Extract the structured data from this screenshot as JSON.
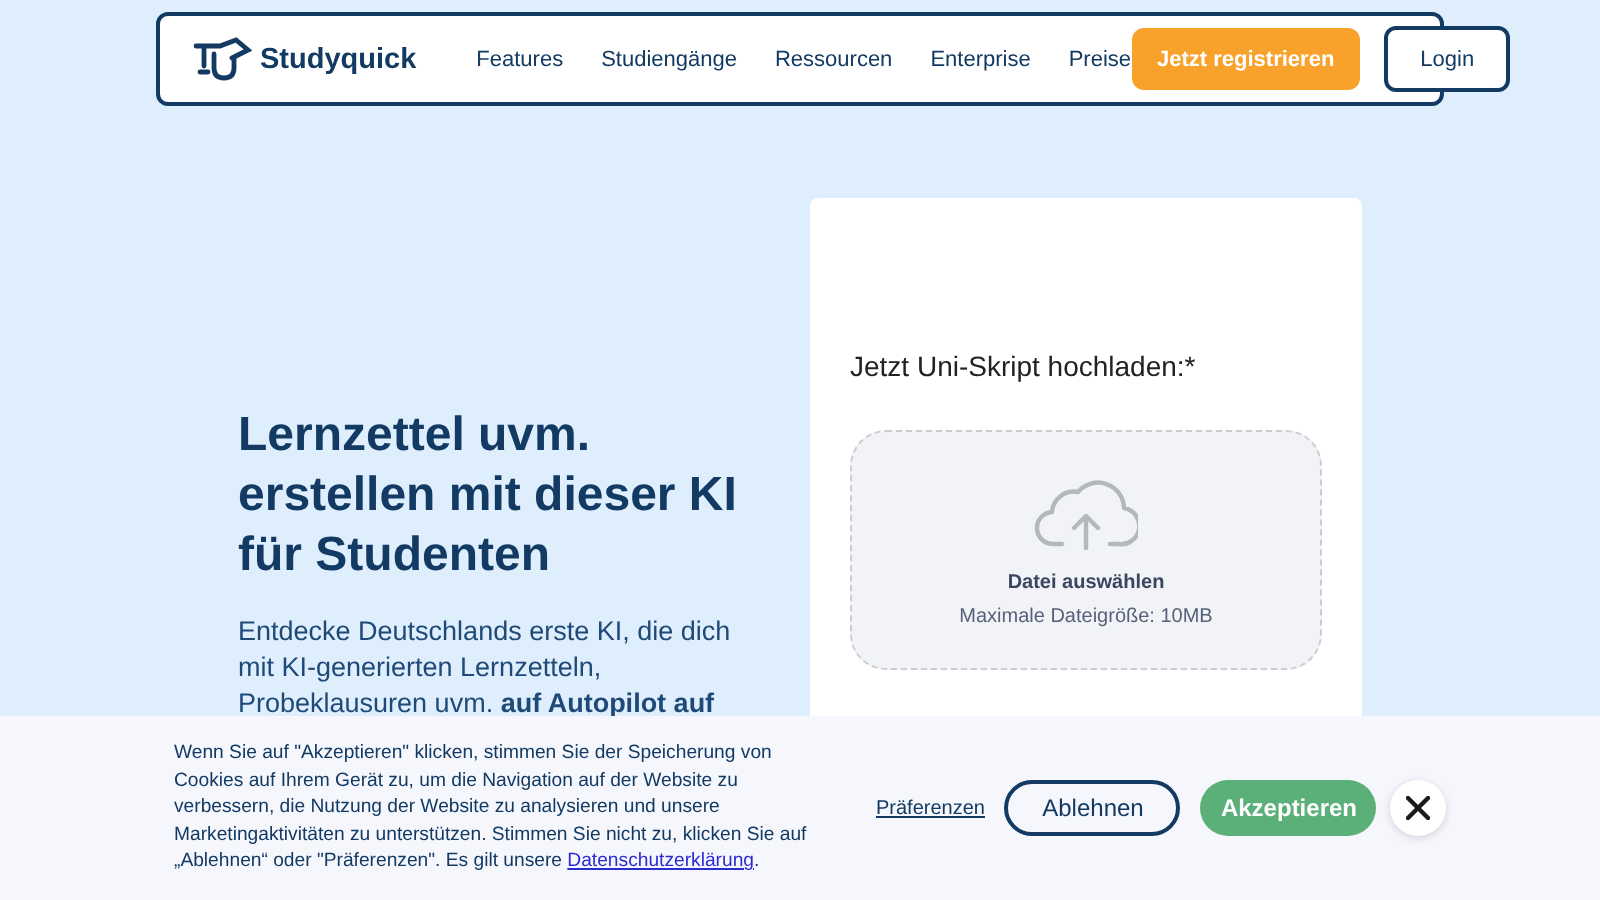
{
  "nav": {
    "logo": "Studyquick",
    "links": [
      "Features",
      "Studiengänge",
      "Ressourcen",
      "Enterprise",
      "Preise"
    ],
    "register": "Jetzt registrieren",
    "login": "Login"
  },
  "hero": {
    "title": "Lernzettel uvm. erstellen mit dieser KI für Studenten",
    "text": "Entdecke Deutschlands erste KI, die dich mit KI-generierten Lernzetteln, Probeklausuren uvm. **auf Autopilot auf**"
  },
  "upload": {
    "label": "Jetzt Uni-Skript hochladen:*",
    "choose": "Datei auswählen",
    "limit": "Maximale Dateigröße: 10MB"
  },
  "cookie": {
    "text": "Wenn Sie auf \"Akzeptieren\" klicken, stimmen Sie der Speicherung von Cookies auf Ihrem Gerät zu, um die Navigation auf der Website zu verbessern, die Nutzung der Website zu analysieren und unsere Marketingaktivitäten zu unterstützen. Stimmen Sie nicht zu, klicken Sie auf „Ablehnen“ oder \"Präferenzen\". Es gilt unsere",
    "policy_link": "Datenschutzerklärung",
    "after_link": ".",
    "preferences": "Präferenzen",
    "decline": "Ablehnen",
    "accept": "Akzeptieren"
  }
}
